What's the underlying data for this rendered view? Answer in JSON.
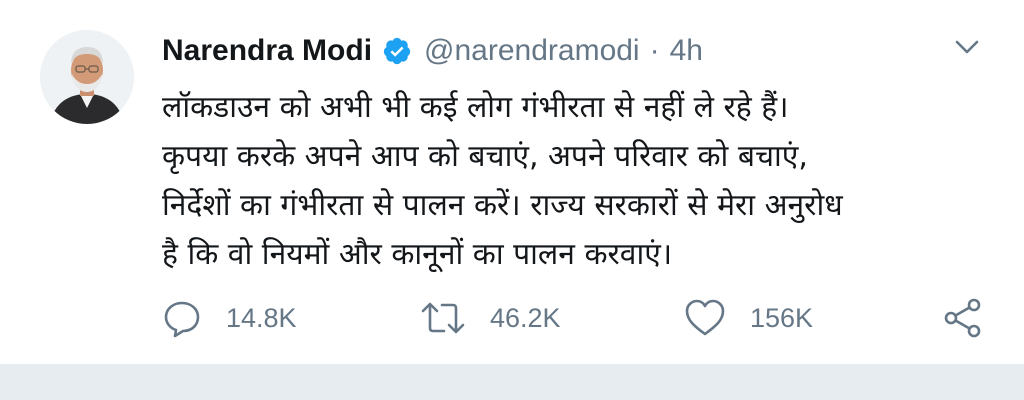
{
  "tweet": {
    "author": {
      "name": "Narendra Modi",
      "handle": "@narendramodi",
      "verified": true,
      "avatar": "profile-photo"
    },
    "separator": "·",
    "time": "4h",
    "text_lines": [
      "लॉकडाउन को अभी भी कई लोग गंभीरता से नहीं ले रहे हैं।",
      "कृपया करके अपने आप को बचाएं, अपने परिवार को बचाएं,",
      "निर्देशों का गंभीरता से पालन करें। राज्य सरकारों से मेरा अनुरोध",
      "है कि वो नियमों और कानूनों का पालन करवाएं।"
    ],
    "actions": {
      "reply": {
        "icon": "reply-icon",
        "count": "14.8K"
      },
      "retweet": {
        "icon": "retweet-icon",
        "count": "46.2K"
      },
      "like": {
        "icon": "heart-icon",
        "count": "156K"
      },
      "share": {
        "icon": "share-icon"
      }
    }
  },
  "colors": {
    "text": "#14171a",
    "secondary": "#657786",
    "verified": "#1da1f2",
    "divider": "#e6ecf0"
  }
}
